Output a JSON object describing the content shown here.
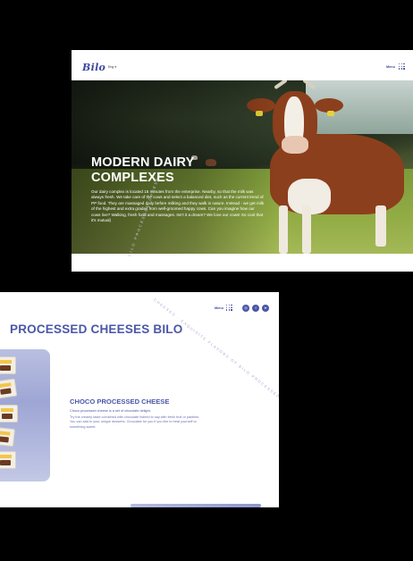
{
  "header": {
    "logo": "Bilo",
    "language": "Eng ▾",
    "menu_label": "Menu"
  },
  "hero": {
    "title": "MODERN DAIRY COMPLEXES",
    "text": "Our dairy complex is located 15 minutes from the enterprise. Nearby, so that the milk was always fresh. We take care of the cows and select a balanced diet, such as the current trend of PP food. They are massaged daily before milking and they walk in nature. Instead - we get milk of the highest and extra grades from well-groomed happy cows. Can you imagine how our cows live? Walking, fresh food and massages. Isn't it a dream? We love our cows! So cool that it's mutual)",
    "watermark": "BILO PROCESSED CHEESES"
  },
  "products_section": {
    "menu_label": "Menu",
    "social_icons": [
      "instagram-icon",
      "facebook-icon",
      "telegram-icon"
    ],
    "title": "PROCESSED CHEESES BILO",
    "product": {
      "name": "CHOCO PROCESSED CHEESE",
      "subtitle": "Choco processed cheese is a set of chocolate delight.",
      "description": "Try the creamy taste combined with chocolate indeed to say with fresh fruit or pastries. You can add to your unique desserts. Chocolate for you if you like to treat yourself to something sweet."
    },
    "arc_text": "CHEESES · EXQUISITE FLAVORS OF BILO PROCESSED CHEESES"
  },
  "colors": {
    "brand": "#4b57a8",
    "background": "#000000",
    "card": "#ffffff"
  }
}
